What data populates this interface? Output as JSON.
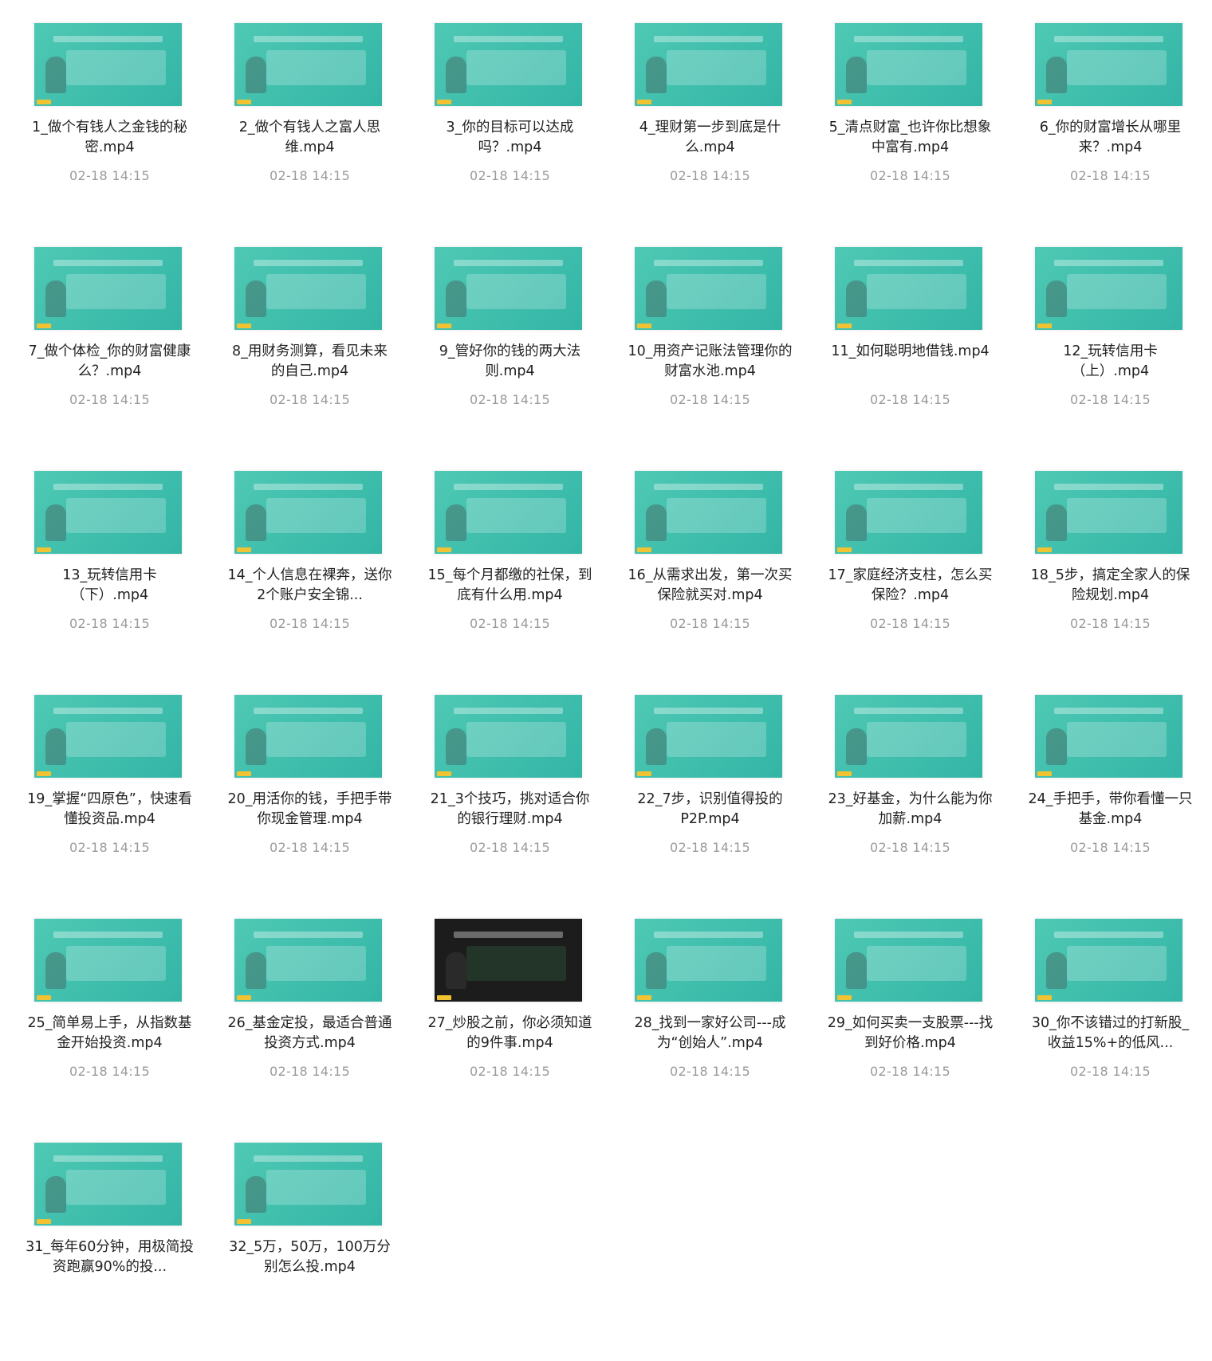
{
  "files": [
    {
      "title": "1_做个有钱人之金钱的秘密.mp4",
      "date": "02-18 14:15"
    },
    {
      "title": "2_做个有钱人之富人思维.mp4",
      "date": "02-18 14:15"
    },
    {
      "title": "3_你的目标可以达成吗？.mp4",
      "date": "02-18 14:15"
    },
    {
      "title": "4_理财第一步到底是什么.mp4",
      "date": "02-18 14:15"
    },
    {
      "title": "5_清点财富_也许你比想象中富有.mp4",
      "date": "02-18 14:15"
    },
    {
      "title": "6_你的财富增长从哪里来？.mp4",
      "date": "02-18 14:15"
    },
    {
      "title": "7_做个体检_你的财富健康么？.mp4",
      "date": "02-18 14:15"
    },
    {
      "title": "8_用财务测算，看见未来的自己.mp4",
      "date": "02-18 14:15"
    },
    {
      "title": "9_管好你的钱的两大法则.mp4",
      "date": "02-18 14:15"
    },
    {
      "title": "10_用资产记账法管理你的财富水池.mp4",
      "date": "02-18 14:15"
    },
    {
      "title": "11_如何聪明地借钱.mp4",
      "date": "02-18 14:15"
    },
    {
      "title": "12_玩转信用卡（上）.mp4",
      "date": "02-18 14:15"
    },
    {
      "title": "13_玩转信用卡 （下）.mp4",
      "date": "02-18 14:15"
    },
    {
      "title": "14_个人信息在裸奔，送你2个账户安全锦...",
      "date": "02-18 14:15"
    },
    {
      "title": "15_每个月都缴的社保，到底有什么用.mp4",
      "date": "02-18 14:15"
    },
    {
      "title": "16_从需求出发，第一次买保险就买对.mp4",
      "date": "02-18 14:15"
    },
    {
      "title": "17_家庭经济支柱，怎么买保险？.mp4",
      "date": "02-18 14:15"
    },
    {
      "title": "18_5步，搞定全家人的保险规划.mp4",
      "date": "02-18 14:15"
    },
    {
      "title": "19_掌握“四原色”，快速看懂投资品.mp4",
      "date": "02-18 14:15"
    },
    {
      "title": "20_用活你的钱，手把手带你现金管理.mp4",
      "date": "02-18 14:15"
    },
    {
      "title": "21_3个技巧，挑对适合你的银行理财.mp4",
      "date": "02-18 14:15"
    },
    {
      "title": "22_7步，识别值得投的P2P.mp4",
      "date": "02-18 14:15"
    },
    {
      "title": "23_好基金，为什么能为你加薪.mp4",
      "date": "02-18 14:15"
    },
    {
      "title": "24_手把手，带你看懂一只基金.mp4",
      "date": "02-18 14:15"
    },
    {
      "title": "25_简单易上手，从指数基金开始投资.mp4",
      "date": "02-18 14:15"
    },
    {
      "title": "26_基金定投，最适合普通投资方式.mp4",
      "date": "02-18 14:15"
    },
    {
      "title": "27_炒股之前，你必须知道的9件事.mp4",
      "date": "02-18 14:15"
    },
    {
      "title": "28_找到一家好公司---成为“创始人”.mp4",
      "date": "02-18 14:15"
    },
    {
      "title": "29_如何买卖一支股票---找到好价格.mp4",
      "date": "02-18 14:15"
    },
    {
      "title": "30_你不该错过的打新股_收益15%+的低风...",
      "date": "02-18 14:15"
    },
    {
      "title": "31_每年60分钟，用极简投资跑赢90%的投...",
      "date": ""
    },
    {
      "title": "32_5万，50万，100万分别怎么投.mp4",
      "date": ""
    }
  ]
}
